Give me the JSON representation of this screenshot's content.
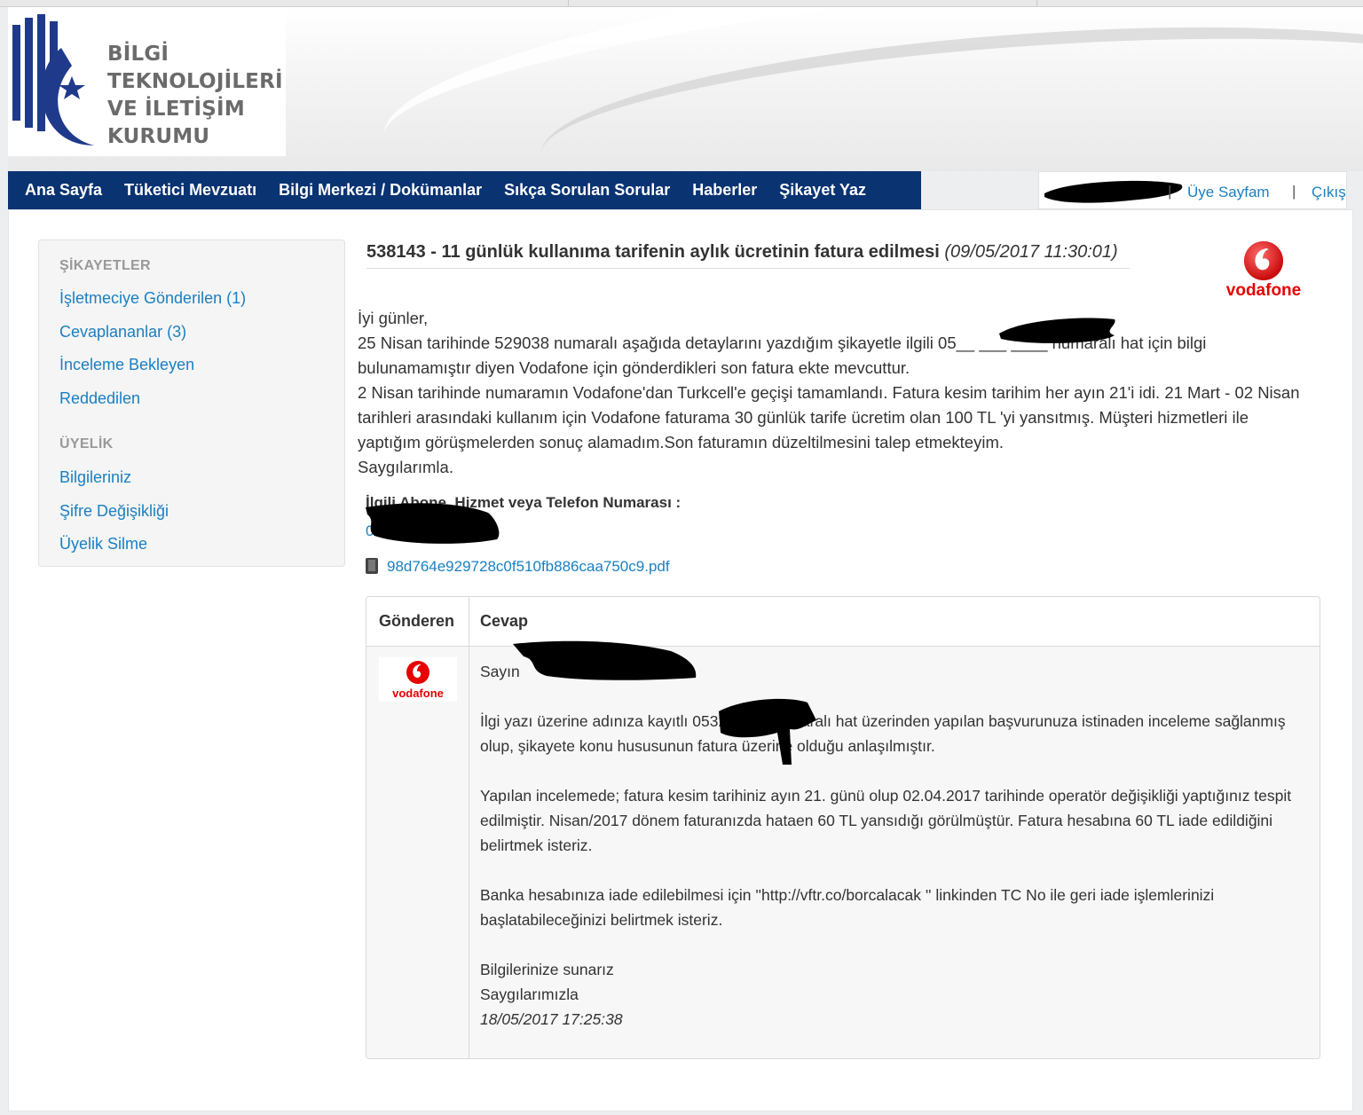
{
  "org_logo": {
    "lines": [
      "BİLGİ",
      "TEKNOLOJİLERİ",
      "VE İLETİŞİM",
      "KURUMU"
    ]
  },
  "nav": {
    "items": [
      "Ana Sayfa",
      "Tüketici Mevzuatı",
      "Bilgi Merkezi / Dokümanlar",
      "Sıkça Sorulan Sorular",
      "Haberler",
      "Şikayet Yaz"
    ]
  },
  "user_menu": {
    "separator": "|",
    "profile": "Üye Sayfam",
    "logout": "Çıkış"
  },
  "sidebar": {
    "complaints_heading": "ŞİKAYETLER",
    "complaints": [
      "İşletmeciye Gönderilen (1)",
      "Cevaplananlar (3)",
      "İnceleme Bekleyen",
      "Reddedilen"
    ],
    "membership_heading": "ÜYELİK",
    "membership": [
      "Bilgileriniz",
      "Şifre Değişikliği",
      "Üyelik Silme"
    ]
  },
  "complaint": {
    "title": "538143 - 11 günlük kullanıma tarifenin aylık ücretinin fatura edilmesi",
    "date": "(09/05/2017 11:30:01)",
    "operator_logo": "vodafone",
    "body": [
      "İyi günler,",
      "25 Nisan tarihinde 529038 numaralı aşağıda detaylarını yazdığım şikayetle ilgili 05__ ___ ____ numaralı hat için bilgi bulunamamıştır diyen Vodafone için gönderdikleri son fatura ekte mevcuttur.",
      "2 Nisan tarihinde numaramın Vodafone'dan Turkcell'e geçişi tamamlandı. Fatura kesim tarihim her ayın 21'i idi. 21 Mart - 02 Nisan tarihleri arasındaki kullanım için Vodafone faturama 30 günlük tarife ücretim olan 100 TL 'yi yansıtmış. Müşteri hizmetleri ile yaptığım görüşmelerden sonuç alamadım.Son faturamın düzeltilmesini talep etmekteyim.",
      "Saygılarımla."
    ],
    "service_label": "İlgili Abone, Hizmet veya Telefon Numarası :",
    "service_value": "05",
    "attachment": "98d764e929728c0f510fb886caa750c9.pdf"
  },
  "reply_table": {
    "col_sender": "Gönderen",
    "col_reply": "Cevap",
    "sender_logo": "vodafone",
    "greeting": "Sayın",
    "paragraphs": [
      "İlgi yazı üzerine adınıza kayıtlı 0532 GSM numaralı hat üzerinden yapılan başvurunuza istinaden inceleme sağlanmış olup, şikayete konu hususunun fatura üzerine olduğu anlaşılmıştır.",
      "Yapılan incelemede; fatura kesim tarihiniz ayın 21. günü olup 02.04.2017 tarihinde operatör değişikliği yaptığınız tespit edilmiştir. Nisan/2017 dönem faturanızda hataen 60 TL yansıdığı görülmüştür. Fatura hesabına 60 TL iade edildiğini belirtmek isteriz.",
      "Banka hesabınıza iade edilebilmesi için ''http://vftr.co/borcalacak '' linkinden TC No ile geri iade işlemlerinizi başlatabileceğinizi belirtmek isteriz."
    ],
    "closing1": "Bilgilerinize sunarız",
    "closing2": "Saygılarımızla",
    "timestamp": "18/05/2017 17:25:38"
  },
  "colors": {
    "nav_bg": "#0a3372",
    "link": "#1a7fc1",
    "vodafone_red": "#e60000"
  }
}
